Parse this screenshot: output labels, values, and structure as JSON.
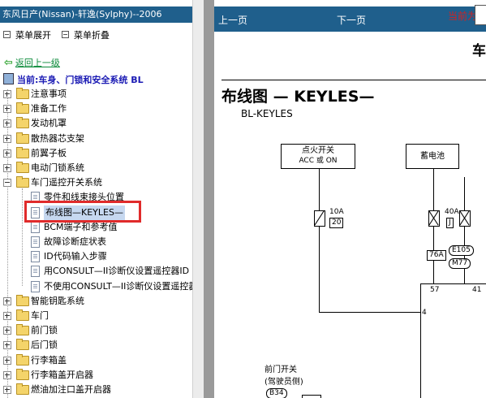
{
  "left_panel": {
    "title": "东风日产(Nissan)-轩逸(Sylphy)--2006",
    "menu_expand": "菜单展开",
    "menu_collapse": "菜单折叠",
    "back": "返回上一级",
    "current": "当前:车身、门锁和安全系统 BL",
    "tree": [
      {
        "label": "注意事项",
        "type": "folder"
      },
      {
        "label": "准备工作",
        "type": "folder"
      },
      {
        "label": "发动机罩",
        "type": "folder"
      },
      {
        "label": "散热器芯支架",
        "type": "folder"
      },
      {
        "label": "前翼子板",
        "type": "folder"
      },
      {
        "label": "电动门锁系统",
        "type": "folder"
      },
      {
        "label": "车门遥控开关系统",
        "type": "folder-open"
      },
      {
        "label": "零件和线束接头位置",
        "type": "doc"
      },
      {
        "label": "布线图—KEYLES—",
        "type": "doc",
        "selected": true
      },
      {
        "label": "BCM端子和参考值",
        "type": "doc"
      },
      {
        "label": "故障诊断症状表",
        "type": "doc"
      },
      {
        "label": "ID代码输入步骤",
        "type": "doc"
      },
      {
        "label": "用CONSULT—II诊断仪设置遥控器ID",
        "type": "doc"
      },
      {
        "label": "不使用CONSULT—II诊断仪设置遥控器ID",
        "type": "doc"
      },
      {
        "label": "智能钥匙系统",
        "type": "folder"
      },
      {
        "label": "车门",
        "type": "folder"
      },
      {
        "label": "前门锁",
        "type": "folder"
      },
      {
        "label": "后门锁",
        "type": "folder"
      },
      {
        "label": "行李箱盖",
        "type": "folder"
      },
      {
        "label": "行李箱盖开启器",
        "type": "folder"
      },
      {
        "label": "燃油加注口盖开启器",
        "type": "folder"
      },
      {
        "label": "防盗系统",
        "type": "folder"
      }
    ]
  },
  "toolbar": {
    "prev": "上一页",
    "next": "下一页",
    "current_page_label": "当前为"
  },
  "document": {
    "header_right": "车",
    "title": "布线图 — KEYLES—",
    "code": "BL-KEYLES",
    "ignition_title": "点火开关",
    "ignition_sub": "ACC 或 ON",
    "battery": "蓄电池",
    "fuse1_amp": "10A",
    "fuse1_num": "20",
    "fuse2_amp": "40A",
    "fuse2_num": "J",
    "conn_e105": "E105",
    "conn_m77": "M77",
    "conn_76a": "76A",
    "pin_57": "57",
    "pin_41": "41",
    "pin_4": "4",
    "door_switch_title": "前门开关",
    "door_switch_sub": "(驾驶员侧)",
    "conn_b34": "B34"
  },
  "colors": {
    "title_bar": "#1f5f8c",
    "highlight_box": "#e02b2b",
    "back_link": "#0b8a3a",
    "current_text": "#1a1ab4",
    "page_label": "#d62020"
  }
}
